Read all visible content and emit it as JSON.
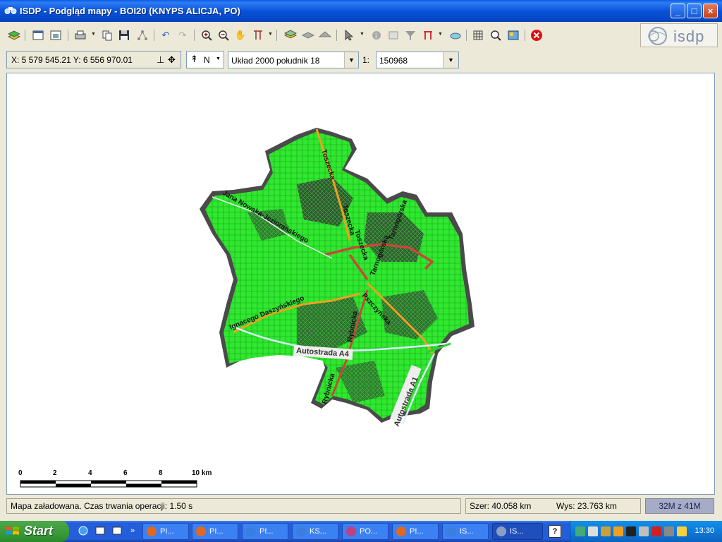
{
  "window": {
    "title": "ISDP - Podgląd mapy - BOI20 (KNYPS ALICJA, PO)",
    "minimize": "_",
    "maximize": "□",
    "close": "×"
  },
  "toolbar": {
    "logo_text": "isdp",
    "tools": [
      "layers-icon",
      "properties-icon",
      "image-icon",
      "print-icon",
      "copy-icon",
      "save-icon",
      "network-icon",
      "undo-icon",
      "redo-icon",
      "zoom-in-icon",
      "zoom-out-icon",
      "pan-hand-icon",
      "measure-icon",
      "layer-add-icon",
      "layer-stack-icon",
      "layer-remove-icon",
      "select-arrow-icon",
      "info-icon",
      "identify-icon",
      "filter-icon",
      "selection-tool-icon",
      "link-icon",
      "grid-icon",
      "search-map-icon",
      "map-export-icon",
      "stop-icon"
    ]
  },
  "coordbar": {
    "coordinates": "X: 5 579 545.21  Y: 6 556 970.01",
    "north_label": "N",
    "projection": "Układ 2000 południk 18",
    "scale_prefix": "1:",
    "scale_value": "150968"
  },
  "map": {
    "streets": [
      "Toszecka",
      "Toszecka",
      "Toszecka",
      "Jana Nowaka-Jeziorańskiego",
      "Tarnogórska",
      "Tarnogórska",
      "Pszczyńska",
      "Ignacego Daszyńskiego",
      "Rybnicka",
      "Rybnicka"
    ],
    "highways": [
      "Autostrada A4",
      "Autostrada A1"
    ],
    "scalebar": {
      "ticks": [
        "0",
        "2",
        "4",
        "6",
        "8",
        "10 km"
      ]
    },
    "colors": {
      "land": "#33ff33",
      "urban": "#3a3a3a",
      "main_road": "#cc4433",
      "road_orange": "#f0a020"
    }
  },
  "statusbar": {
    "message": "Mapa załadowana. Czas trwania operacji: 1.50 s",
    "width": "Szer: 40.058 km",
    "height": "Wys: 23.763 km",
    "memory": "32M z 41M"
  },
  "taskbar": {
    "start_label": "Start",
    "more": "»",
    "tasks": [
      {
        "label": "PI...",
        "color": "#e06820"
      },
      {
        "label": "PI...",
        "color": "#e06820"
      },
      {
        "label": "PI...",
        "color": "#3a7ee0"
      },
      {
        "label": "KS...",
        "color": "#3a7ee0"
      },
      {
        "label": "PO...",
        "color": "#c04080"
      },
      {
        "label": "PI...",
        "color": "#e06820"
      },
      {
        "label": "IS...",
        "color": "#3a7ee0"
      },
      {
        "label": "IS...",
        "color": "#8aa0c0"
      }
    ],
    "help": "?",
    "clock": "13:30"
  }
}
